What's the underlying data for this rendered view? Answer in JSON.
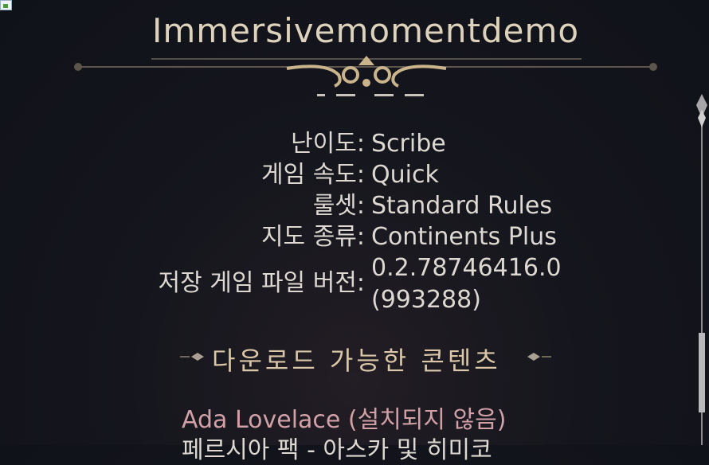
{
  "title": "Immersivemomentdemo",
  "details": [
    {
      "label": "난이도:",
      "value": "Scribe"
    },
    {
      "label": "게임 속도:",
      "value": "Quick"
    },
    {
      "label": "룰셋:",
      "value": "Standard Rules"
    },
    {
      "label": "지도 종류:",
      "value": "Continents Plus"
    },
    {
      "label": "저장 게임 파일 버전:",
      "value": "0.2.78746416.0",
      "value2": "(993288)"
    }
  ],
  "dlc": {
    "header": "다운로드 가능한 콘텐츠",
    "items": [
      {
        "text": "Ada Lovelace (설치되지 않음)",
        "color": "#d2a1a8"
      },
      {
        "text": "페르시아 팩 - 아스카 및 히미코",
        "color": "#ddd9d2"
      }
    ]
  },
  "colors": {
    "accent": "#c9b48c",
    "background": "#13151c"
  }
}
